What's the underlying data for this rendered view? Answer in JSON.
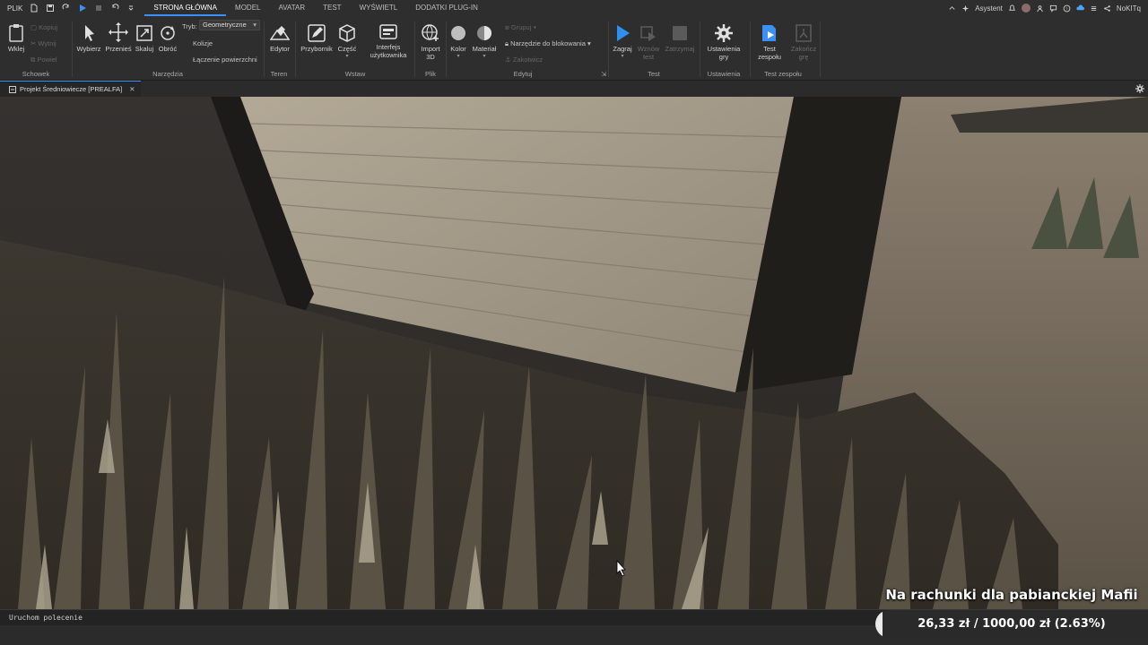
{
  "menubar": {
    "file": "PLIK",
    "tabs": [
      "STRONA GŁÓWNA",
      "MODEL",
      "AVATAR",
      "TEST",
      "WYŚWIETL",
      "DODATKI PLUG-IN"
    ],
    "active_tab": "STRONA GŁÓWNA",
    "assistant": "Asystent",
    "username": "NoKITq"
  },
  "ribbon": {
    "clipboard": {
      "paste": "Wklej",
      "copy": "Kopiuj",
      "cut": "Wytnij",
      "duplicate": "Powiel",
      "group": "Schowek"
    },
    "tools": {
      "select": "Wybierz",
      "move": "Przenieś",
      "scale": "Skaluj",
      "rotate": "Obróć",
      "mode_label": "Tryb:",
      "mode_value": "Geometryczne",
      "collisions": "Kolizje",
      "join_surfaces": "Łączenie powierzchni",
      "group": "Narzędzia"
    },
    "terrain": {
      "editor": "Edytor",
      "group": "Teren"
    },
    "insert": {
      "toolbox": "Przybornik",
      "part": "Część",
      "ui_1": "Interfejs",
      "ui_2": "użytkownika",
      "group": "Wstaw"
    },
    "file": {
      "import_1": "Import",
      "import_2": "3D",
      "group": "Plik"
    },
    "edit": {
      "color": "Kolor",
      "material": "Materiał",
      "group_btn": "Grupuj",
      "lock_tool": "Narzędzie do blokowania",
      "anchor": "Zakotwicz",
      "group": "Edytuj"
    },
    "test": {
      "play": "Zagraj",
      "resume_1": "Wznów",
      "resume_2": "test",
      "stop": "Zatrzymaj",
      "group": "Test"
    },
    "settings": {
      "game_1": "Ustawienia",
      "game_2": "gry",
      "group": "Ustawienia"
    },
    "team_test": {
      "team_1": "Test",
      "team_2": "zespołu",
      "exit_1": "Zakończ",
      "exit_2": "grę",
      "group": "Test zespołu"
    }
  },
  "document_tab": {
    "title": "Projekt Średniowiecze [PREALFA]"
  },
  "command_bar": {
    "placeholder": "Uruchom polecenie"
  },
  "donation": {
    "title": "Na rachunki dla pabianckiej Mafii",
    "progress_text": "26,33 zł / 1000,00 zł (2.63%)",
    "progress_fraction": 0.0263
  },
  "colors": {
    "accent": "#3b8ff5",
    "play": "#2f8fef",
    "wall": "#a39a88",
    "grass": "#4a4436"
  }
}
